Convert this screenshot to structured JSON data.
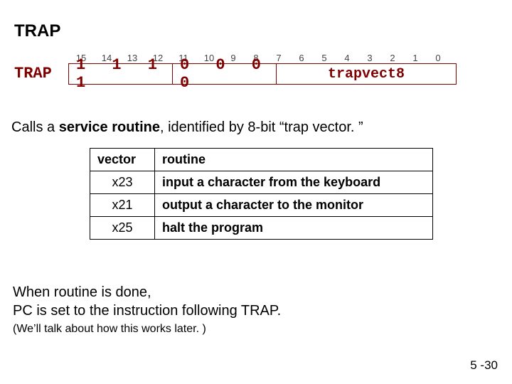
{
  "title": "TRAP",
  "instruction": {
    "bit_labels": [
      "15",
      "14",
      "13",
      "12",
      "11",
      "10",
      "9",
      "8",
      "7",
      "6",
      "5",
      "4",
      "3",
      "2",
      "1",
      "0"
    ],
    "mnemonic": "TRAP",
    "opcode": "1 1 1 1",
    "zeros": "0 0 0 0",
    "trapvect_label": "trapvect8"
  },
  "desc": {
    "prefix": "Calls a ",
    "bold": "service routine",
    "suffix": ", identified by 8-bit “trap vector. ”"
  },
  "table": {
    "headers": {
      "vector": "vector",
      "routine": "routine"
    },
    "rows": [
      {
        "vector": "x23",
        "routine": "input a character from the keyboard"
      },
      {
        "vector": "x21",
        "routine": "output a character to the monitor"
      },
      {
        "vector": "x25",
        "routine": "halt the program"
      }
    ]
  },
  "footer": {
    "line1a": "When routine is done,",
    "line1b": "PC is set to the instruction following TRAP.",
    "line2": "(We’ll talk about how this works later. )"
  },
  "page": "5 -30"
}
